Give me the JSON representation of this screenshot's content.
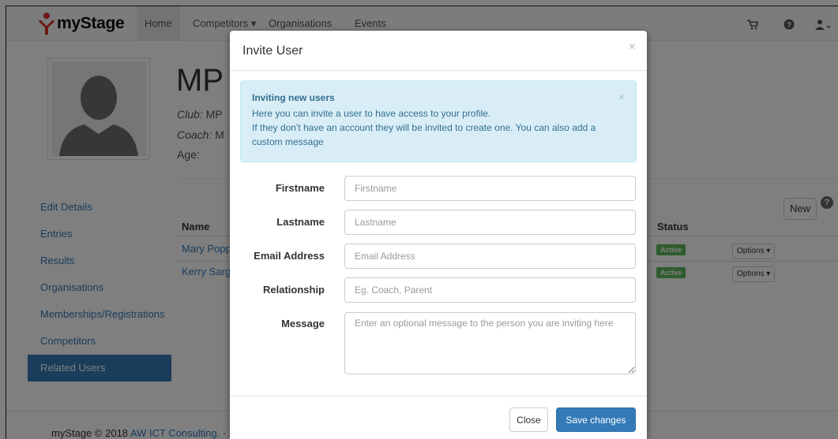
{
  "navbar": {
    "brand": "myStage",
    "items": [
      {
        "label": "Home"
      },
      {
        "label": "Competitors ▾"
      },
      {
        "label": "Organisations"
      },
      {
        "label": "Events"
      }
    ],
    "icons": [
      "cart-icon",
      "help-icon",
      "user-icon"
    ]
  },
  "profile": {
    "title": "MP I",
    "club_label": "Club:",
    "club_value": "MP",
    "coach_label": "Coach:",
    "coach_value": "M",
    "age_label": "Age:"
  },
  "sidebar": {
    "items": [
      {
        "label": "Edit Details"
      },
      {
        "label": "Entries"
      },
      {
        "label": "Results"
      },
      {
        "label": "Organisations"
      },
      {
        "label": "Memberships/Registrations"
      },
      {
        "label": "Competitors"
      },
      {
        "label": "Related Users"
      }
    ],
    "active_index": 6
  },
  "table": {
    "headers": {
      "name": "Name",
      "status": "Status"
    },
    "rows": [
      {
        "name": "Mary Poppi",
        "status": "Active",
        "options": "Options ▾"
      },
      {
        "name": "Kerry Sarge",
        "status": "Active",
        "options": "Options ▾"
      }
    ],
    "new_button": "New"
  },
  "footer": {
    "prefix": "myStage © 2018 ",
    "link": "AW ICT Consulting.",
    "suffix": " · Bi"
  },
  "modal": {
    "title": "Invite User",
    "alert": {
      "title": "Inviting new users",
      "line1": "Here you can invite a user to have access to your profile.",
      "line2": "If they don't have an account they will be invited to create one. You can also add a custom message"
    },
    "fields": {
      "firstname": {
        "label": "Firstname",
        "placeholder": "Firstname",
        "value": ""
      },
      "lastname": {
        "label": "Lastname",
        "placeholder": "Lastname",
        "value": ""
      },
      "email": {
        "label": "Email Address",
        "placeholder": "Email Address",
        "value": ""
      },
      "relationship": {
        "label": "Relationship",
        "placeholder": "Eg. Coach, Parent",
        "value": ""
      },
      "message": {
        "label": "Message",
        "placeholder": "Enter an optional message to the person you are inviting here",
        "value": ""
      }
    },
    "close_button": "Close",
    "save_button": "Save changes"
  },
  "colors": {
    "primary": "#337ab7",
    "success": "#5cb85c",
    "alert_bg": "#d9edf7",
    "alert_text": "#31708f"
  }
}
